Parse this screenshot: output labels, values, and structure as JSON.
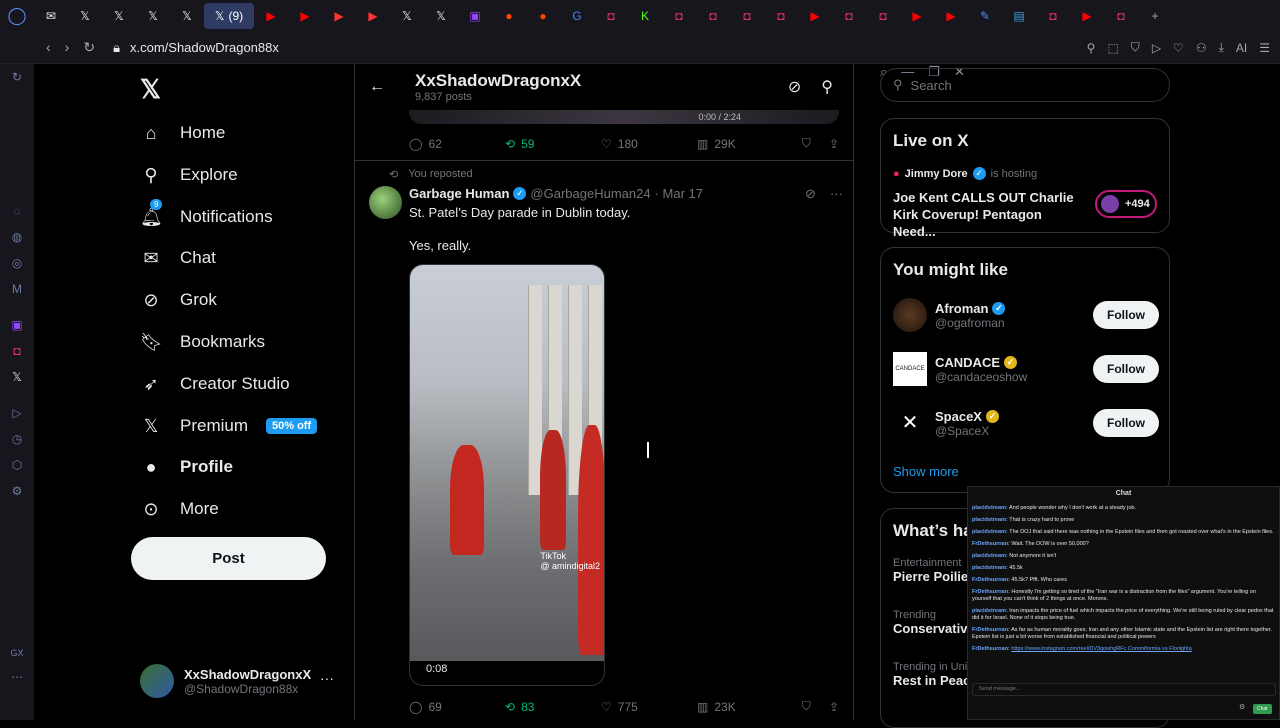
{
  "browser": {
    "tabs_active_label": "(9)",
    "url": "x.com/ShadowDragon88x",
    "ai_label": "AI"
  },
  "nav": {
    "items": [
      {
        "label": "Home"
      },
      {
        "label": "Explore"
      },
      {
        "label": "Notifications",
        "badge": "9"
      },
      {
        "label": "Chat"
      },
      {
        "label": "Grok"
      },
      {
        "label": "Bookmarks"
      },
      {
        "label": "Creator Studio"
      },
      {
        "label": "Premium",
        "badge": "50% off"
      },
      {
        "label": "Profile"
      },
      {
        "label": "More"
      }
    ],
    "post_button": "Post",
    "account": {
      "name": "XxShadowDragonxX",
      "handle": "@ShadowDragon88x"
    }
  },
  "profile_header": {
    "title": "XxShadowDragonxX",
    "posts": "9,837 posts"
  },
  "prev_post_actions": {
    "replies": "62",
    "reposts": "59",
    "likes": "180",
    "views": "29K"
  },
  "prev_video_time": "0:00 / 2:24",
  "tweet": {
    "reposted_label": "You reposted",
    "author": "Garbage Human",
    "handle": "@GarbageHuman24",
    "date": "· Mar 17",
    "text1": "St. Patel’s Day parade in Dublin today.",
    "text2": "Yes, really.",
    "video_time": "0:08",
    "tiktok": "TikTok",
    "tiktok_handle": "@ amindigital2",
    "actions": {
      "replies": "69",
      "reposts": "83",
      "likes": "775",
      "views": "23K"
    }
  },
  "right": {
    "search_placeholder": "Search",
    "live": {
      "heading": "Live on X",
      "host_name": "Jimmy Dore",
      "host_label": "is hosting",
      "title": "Joe Kent CALLS OUT Charlie Kirk Coverup! Pentagon Need...",
      "count": "+494"
    },
    "you_might_like": {
      "heading": "You might like",
      "follow_label": "Follow",
      "show_more": "Show more",
      "accounts": [
        {
          "name": "Afroman",
          "handle": "@ogafroman",
          "badge": "blue"
        },
        {
          "name": "CANDACE",
          "handle": "@candaceoshow",
          "badge": "gold"
        },
        {
          "name": "SpaceX",
          "handle": "@SpaceX",
          "badge": "gold"
        }
      ]
    },
    "whats_happening": {
      "heading": "What’s ha",
      "trends": [
        {
          "category": "Entertainment",
          "topic": "Pierre Poilie"
        },
        {
          "category": "Trending",
          "topic": "Conservativ"
        },
        {
          "category": "Trending in Uni",
          "topic": "Rest in Peac"
        }
      ]
    }
  },
  "chat": {
    "title": "Chat",
    "messages": [
      {
        "user": "placidstream:",
        "text": "And people wonder why I don't work at a steady job."
      },
      {
        "user": "placidstream:",
        "text": "That is crazy hard to prove"
      },
      {
        "user": "placidstream:",
        "text": "The DOJ that said there was nothing in the Epstein files and then got roasted over what's in the Epstein files."
      },
      {
        "user": "FrDethsurnan:",
        "text": "Wait. The DOW is over 50,000?"
      },
      {
        "user": "placidstream:",
        "text": "Not anymore it isn't"
      },
      {
        "user": "placidstream:",
        "text": "45.5k"
      },
      {
        "user": "FrDethsurnan:",
        "text": "45.5k? Pfft. Who cares"
      },
      {
        "user": "FrDethsurnan:",
        "text": "Honestly I'm getting so tired of the \"Iran war is a distraction from the files\" argument. You're telling on yourself that you can't think of 2 things at once. Morons."
      },
      {
        "user": "placidstream:",
        "text": "Iran impacts the price of fuel which impacts the price of everything. We're still being ruled by clear pedos that did it for Israel. None of it stops being true."
      },
      {
        "user": "FrDethsurnan:",
        "text": "As far as human morality goes; Iran and any other Islamic state and the Epstein list are right there together. Epstein list is just a bit worse from established financial and political powers"
      },
      {
        "user": "FrDethsurnan:",
        "text": "https://www.instagram.com/reel/DV3qowhgRFc Commiformia vs Floriighta"
      }
    ],
    "input_placeholder": "Send message...",
    "send_label": "Chat"
  }
}
